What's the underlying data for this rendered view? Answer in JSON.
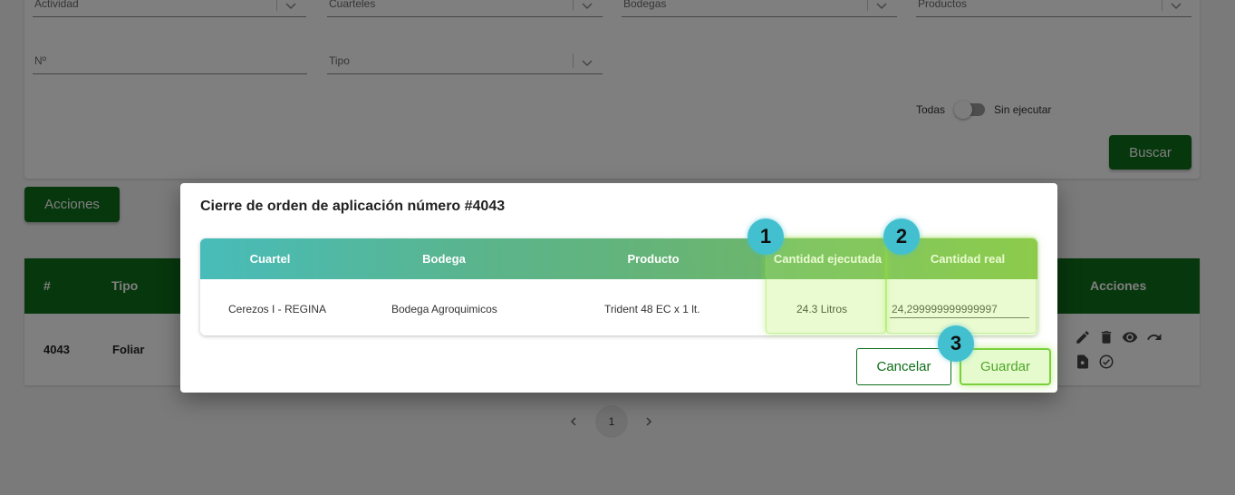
{
  "filters": {
    "actividad": "Actividad",
    "cuarteles": "Cuarteles",
    "bodegas": "Bodegas",
    "productos": "Productos",
    "numero": "Nº",
    "tipo": "Tipo",
    "toggle_left": "Todas",
    "toggle_right": "Sin ejecutar",
    "toggle_on": false,
    "buscar": "Buscar"
  },
  "acciones_button": "Acciones",
  "table": {
    "headers": {
      "num": "#",
      "tipo": "Tipo",
      "acciones": "Acciones"
    },
    "rows": [
      {
        "num": "4043",
        "tipo": "Foliar"
      }
    ],
    "action_icons": [
      "pencil-icon",
      "trash-icon",
      "eye-icon",
      "redo-icon",
      "file-search-icon",
      "check-circle-icon"
    ]
  },
  "pagination": {
    "current": "1"
  },
  "modal": {
    "title": "Cierre de orden de aplicación número #4043",
    "columns": {
      "cuartel": "Cuartel",
      "bodega": "Bodega",
      "producto": "Producto",
      "cantidad_ejecutada": "Cantidad ejecutada",
      "cantidad_real": "Cantidad real"
    },
    "row": {
      "cuartel": "Cerezos I - REGINA",
      "bodega": "Bodega Agroquimicos",
      "producto": "Trident 48 EC x 1 lt.",
      "cantidad_ejecutada": "24.3 Litros",
      "cantidad_real": "24,299999999999997"
    },
    "cancel": "Cancelar",
    "save": "Guardar"
  },
  "badges": {
    "b1": "1",
    "b2": "2",
    "b3": "3"
  },
  "colors": {
    "brand_green": "#0e6e1a",
    "badge": "#43c0d0",
    "highlight": "#b4f05a"
  }
}
